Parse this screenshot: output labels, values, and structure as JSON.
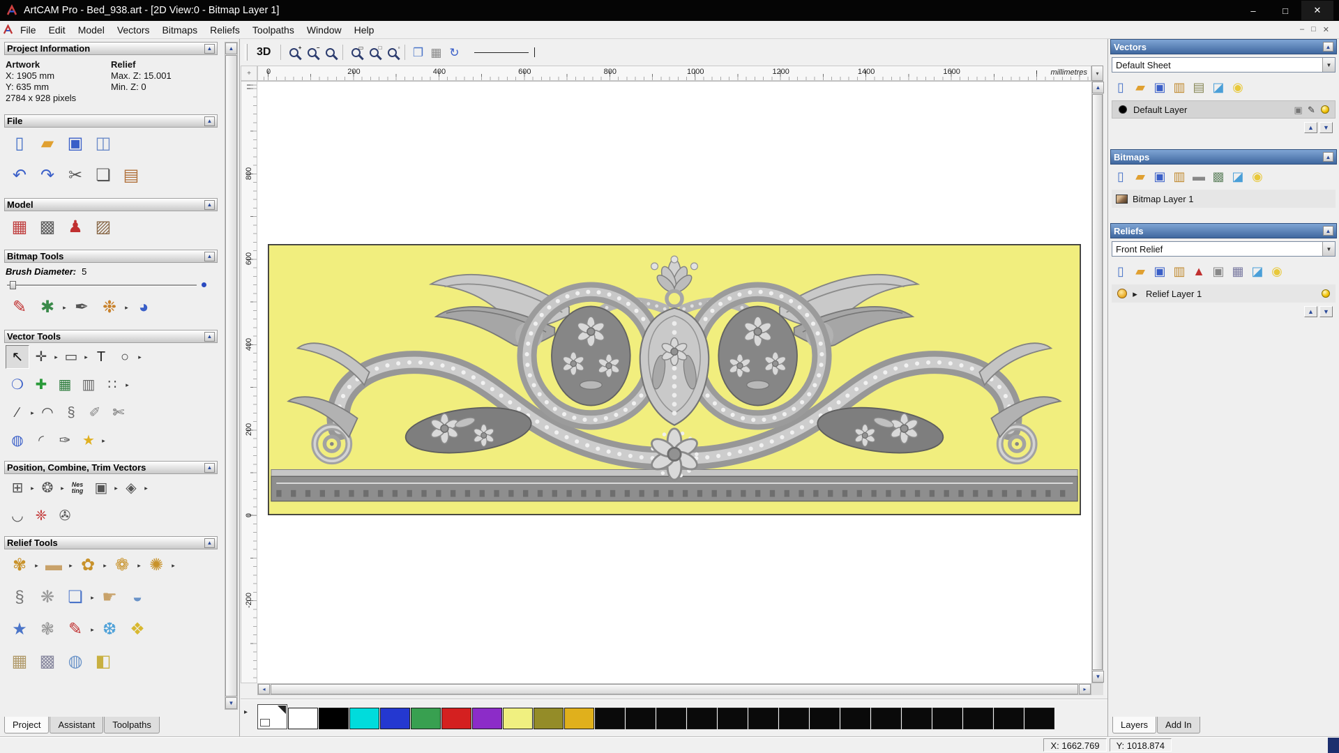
{
  "ui": {
    "collapse_glyph": "▲",
    "dropdown_glyph": "▼",
    "scroll_up": "▲",
    "scroll_down": "▼",
    "scroll_left": "◂",
    "scroll_right": "▸",
    "corner_glyph": "+",
    "ruler_split_glyph": "▾",
    "palette_expand_glyph": "▸"
  },
  "window": {
    "title": "ArtCAM Pro - Bed_938.art - [2D View:0 - Bitmap Layer 1]",
    "controls": {
      "minimize": "–",
      "maximize": "□",
      "close": "✕"
    },
    "mdi_controls": {
      "minimize": "–",
      "restore": "□",
      "close": "✕"
    }
  },
  "menu": {
    "items": [
      "File",
      "Edit",
      "Model",
      "Vectors",
      "Bitmaps",
      "Reliefs",
      "Toolpaths",
      "Window",
      "Help"
    ]
  },
  "left_panel": {
    "project_info": {
      "title": "Project Information",
      "artwork_heading": "Artwork",
      "relief_heading": "Relief",
      "x": "X: 1905 mm",
      "y": "Y: 635 mm",
      "pixels": "2784 x 928 pixels",
      "max_z": "Max. Z: 15.001",
      "min_z": "Min. Z: 0"
    },
    "file_section": {
      "title": "File"
    },
    "file_icons_row1": [
      {
        "name": "new-model-icon",
        "glyph": "▯",
        "color": "#4a74c8"
      },
      {
        "name": "open-model-icon",
        "glyph": "▰",
        "color": "#e0a030"
      },
      {
        "name": "save-model-icon",
        "glyph": "▣",
        "color": "#3a5fc8"
      },
      {
        "name": "export-model-icon",
        "glyph": "◫",
        "color": "#6a8ac8"
      }
    ],
    "file_icons_row2": [
      {
        "name": "undo-icon",
        "glyph": "↶",
        "color": "#3a5fc8"
      },
      {
        "name": "redo-icon",
        "glyph": "↷",
        "color": "#3a5fc8"
      },
      {
        "name": "cut-icon",
        "glyph": "✂",
        "color": "#555555"
      },
      {
        "name": "copy-icon",
        "glyph": "❏",
        "color": "#555555"
      },
      {
        "name": "paste-icon",
        "glyph": "▤",
        "color": "#b0703a"
      }
    ],
    "model_section": {
      "title": "Model"
    },
    "model_icons": [
      {
        "name": "set-model-size-icon",
        "glyph": "▦",
        "color": "#c04040"
      },
      {
        "name": "copy-model-icon",
        "glyph": "▩",
        "color": "#606060"
      },
      {
        "name": "lighting-material-icon",
        "glyph": "♟",
        "color": "#c03030"
      },
      {
        "name": "model-picture-icon",
        "glyph": "▨",
        "color": "#8a6a4a"
      }
    ],
    "bitmap_tools": {
      "title": "Bitmap Tools",
      "brush_diameter_label": "Brush Diameter:",
      "brush_diameter_value": "5"
    },
    "bitmap_icons": [
      {
        "name": "paint-brush-icon",
        "glyph": "✎",
        "color": "#c03030"
      },
      {
        "name": "flood-fill-icon",
        "glyph": "✱",
        "color": "#3a8a4a",
        "arrow": true
      },
      {
        "name": "colour-picker-icon",
        "glyph": "✒",
        "color": "#555555"
      },
      {
        "name": "palette-icon",
        "glyph": "❉",
        "color": "#c8812a",
        "arrow": true
      },
      {
        "name": "paint-bucket-icon",
        "glyph": "◕",
        "color": "#3a5fc8"
      }
    ],
    "vector_tools": {
      "title": "Vector Tools"
    },
    "vector_icons_row1": [
      {
        "name": "select-vectors-icon",
        "glyph": "↖",
        "color": "#111111",
        "pressed": true
      },
      {
        "name": "transform-vectors-icon",
        "glyph": "✛",
        "color": "#444444",
        "arrow": true
      },
      {
        "name": "create-rectangle-icon",
        "glyph": "▭",
        "color": "#444444",
        "arrow": true
      },
      {
        "name": "create-text-icon",
        "glyph": "T",
        "color": "#222222"
      },
      {
        "name": "create-ellipse-icon",
        "glyph": "○",
        "color": "#444444",
        "arrow": true
      }
    ],
    "vector_icons_row2": [
      {
        "name": "offset-vectors-icon",
        "glyph": "❍",
        "color": "#3a5fc8"
      },
      {
        "name": "node-editing-icon",
        "glyph": "✚",
        "color": "#2a9a3a"
      },
      {
        "name": "bitmap-to-vector-icon",
        "glyph": "▦",
        "color": "#2a7a3a"
      },
      {
        "name": "paste-along-curve-icon",
        "glyph": "▥",
        "color": "#666666"
      },
      {
        "name": "block-copy-icon",
        "glyph": "∷",
        "color": "#555555",
        "arrow": true
      }
    ],
    "vector_icons_row3": [
      {
        "name": "create-polyline-icon",
        "glyph": "∕",
        "color": "#444444",
        "arrow": true
      },
      {
        "name": "create-arc-icon",
        "glyph": "◠",
        "color": "#444444"
      },
      {
        "name": "convert-to-curves-icon",
        "glyph": "§",
        "color": "#666666"
      },
      {
        "name": "measure-icon",
        "glyph": "✐",
        "color": "#888888"
      },
      {
        "name": "trim-vectors-icon",
        "glyph": "✄",
        "color": "#555555"
      }
    ],
    "vector_icons_row4": [
      {
        "name": "create-cylinder-icon",
        "glyph": "◍",
        "color": "#3a5fc8"
      },
      {
        "name": "fillet-icon",
        "glyph": "◜",
        "color": "#555555"
      },
      {
        "name": "bezier-pen-icon",
        "glyph": "✑",
        "color": "#555555"
      },
      {
        "name": "create-star-icon",
        "glyph": "★",
        "color": "#e0b020",
        "arrow": true
      }
    ],
    "position_section": {
      "title": "Position, Combine, Trim Vectors"
    },
    "position_icons_row1": [
      {
        "name": "block-array-icon",
        "glyph": "⊞",
        "color": "#555555",
        "arrow": true
      },
      {
        "name": "circular-array-icon",
        "glyph": "❂",
        "color": "#555555",
        "arrow": true
      },
      {
        "name": "nesting-icon",
        "glyph": "Nes\nting",
        "color": "#222222",
        "small": true
      },
      {
        "name": "align-vectors-icon",
        "glyph": "▣",
        "color": "#555555",
        "arrow": true
      },
      {
        "name": "weld-vectors-icon",
        "glyph": "◈",
        "color": "#555555",
        "arrow": true
      }
    ],
    "position_icons_row2": [
      {
        "name": "fillet-weld-icon",
        "glyph": "◡",
        "color": "#555555"
      },
      {
        "name": "vector-texture-icon",
        "glyph": "❈",
        "color": "#c03030"
      },
      {
        "name": "spiral-icon",
        "glyph": "✇",
        "color": "#555555"
      }
    ],
    "relief_tools": {
      "title": "Relief Tools"
    },
    "relief_icons_row1": [
      {
        "name": "relief-wizard-icon",
        "glyph": "✾",
        "color": "#c8922a",
        "arrow": true
      },
      {
        "name": "smooth-relief-icon",
        "glyph": "▬",
        "color": "#c8a26a",
        "arrow": true
      },
      {
        "name": "shape-editor-icon",
        "glyph": "✿",
        "color": "#c8922a",
        "arrow": true
      },
      {
        "name": "two-rail-sweep-icon",
        "glyph": "❁",
        "color": "#c8922a",
        "arrow": true
      },
      {
        "name": "extrude-relief-icon",
        "glyph": "✺",
        "color": "#c8922a",
        "arrow": true
      }
    ],
    "relief_icons_row2": [
      {
        "name": "swept-profile-icon",
        "glyph": "§",
        "color": "#777777"
      },
      {
        "name": "weave-wizard-icon",
        "glyph": "❋",
        "color": "#999999"
      },
      {
        "name": "constant-relief-icon",
        "glyph": "❏",
        "color": "#4a74c8",
        "arrow": true
      },
      {
        "name": "interactive-sculpt-icon",
        "glyph": "☛",
        "color": "#c8a26a"
      },
      {
        "name": "dome-relief-icon",
        "glyph": "◒",
        "color": "#6a93c8"
      }
    ],
    "relief_icons_row3": [
      {
        "name": "star-relief-icon",
        "glyph": "★",
        "color": "#4a74c8"
      },
      {
        "name": "wreath-relief-icon",
        "glyph": "❃",
        "color": "#999999"
      },
      {
        "name": "paint-relief-icon",
        "glyph": "✎",
        "color": "#c03030",
        "arrow": true
      },
      {
        "name": "texture-relief-icon",
        "glyph": "❆",
        "color": "#4a9fd8"
      },
      {
        "name": "offset-relief-icon",
        "glyph": "❖",
        "color": "#d8b830"
      }
    ],
    "relief_icons_row4": [
      {
        "name": "pattern-relief-icon",
        "glyph": "▦",
        "color": "#b09a6a"
      },
      {
        "name": "mesh-relief-icon",
        "glyph": "▩",
        "color": "#8a8aa0"
      },
      {
        "name": "clay-relief-icon",
        "glyph": "◍",
        "color": "#6a93c8"
      },
      {
        "name": "layer-relief-icon",
        "glyph": "◧",
        "color": "#c8b040"
      }
    ],
    "tabs": [
      {
        "label": "Project",
        "active": true
      },
      {
        "label": "Assistant",
        "active": false
      },
      {
        "label": "Toolpaths",
        "active": false
      }
    ]
  },
  "canvas": {
    "toolbar": {
      "view_3d": "3D",
      "icons": [
        {
          "name": "separator-1",
          "type": "sep"
        },
        {
          "name": "zoom-in-icon",
          "type": "mag",
          "sub": "+"
        },
        {
          "name": "zoom-out-icon",
          "type": "mag",
          "sub": "−"
        },
        {
          "name": "zoom-previous-icon",
          "type": "mag"
        },
        {
          "name": "separator-2",
          "type": "sep"
        },
        {
          "name": "zoom-window-icon",
          "type": "mag",
          "sub": "▭"
        },
        {
          "name": "zoom-objects-icon",
          "type": "mag",
          "sub": "□"
        },
        {
          "name": "zoom-page-icon",
          "type": "mag",
          "sub": "▫"
        },
        {
          "name": "separator-3",
          "type": "sep"
        },
        {
          "name": "preview-pages-icon",
          "glyph": "❐",
          "color": "#4a74c8"
        },
        {
          "name": "snap-grid-icon",
          "glyph": "▦",
          "color": "#888888"
        },
        {
          "name": "redraw-view-icon",
          "glyph": "↻",
          "color": "#3a5fc8"
        }
      ]
    },
    "ruler": {
      "h_ticks": [
        "0",
        "200",
        "400",
        "600",
        "800",
        "1000",
        "1200",
        "1400",
        "1600"
      ],
      "v_ticks": [
        "800",
        "600",
        "400",
        "200",
        "0",
        "-200"
      ],
      "units": "millimetres"
    }
  },
  "palette": {
    "colors": [
      {
        "name": "current-colour-indicator",
        "color": "#ffffff",
        "special": true
      },
      {
        "name": "colour-white",
        "color": "#ffffff"
      },
      {
        "name": "colour-black",
        "color": "#000000"
      },
      {
        "name": "colour-cyan",
        "color": "#00dcdc"
      },
      {
        "name": "colour-blue",
        "color": "#2438d0"
      },
      {
        "name": "colour-green",
        "color": "#38a050"
      },
      {
        "name": "colour-red",
        "color": "#d42020"
      },
      {
        "name": "colour-magenta",
        "color": "#8c2cc8"
      },
      {
        "name": "colour-light-yellow",
        "color": "#f0f080"
      },
      {
        "name": "colour-olive",
        "color": "#948c28"
      },
      {
        "name": "colour-gold",
        "color": "#e0b01c"
      },
      {
        "name": "colour-black-2",
        "color": "#0a0a0a"
      },
      {
        "name": "colour-black-3",
        "color": "#0a0a0a"
      },
      {
        "name": "colour-black-4",
        "color": "#0a0a0a"
      },
      {
        "name": "colour-black-5",
        "color": "#0a0a0a"
      },
      {
        "name": "colour-black-6",
        "color": "#0a0a0a"
      },
      {
        "name": "colour-black-7",
        "color": "#0a0a0a"
      },
      {
        "name": "colour-black-8",
        "color": "#0a0a0a"
      },
      {
        "name": "colour-black-9",
        "color": "#0a0a0a"
      },
      {
        "name": "colour-black-10",
        "color": "#0a0a0a"
      },
      {
        "name": "colour-black-11",
        "color": "#0a0a0a"
      },
      {
        "name": "colour-black-12",
        "color": "#0a0a0a"
      },
      {
        "name": "colour-black-13",
        "color": "#0a0a0a"
      },
      {
        "name": "colour-black-14",
        "color": "#0a0a0a"
      },
      {
        "name": "colour-black-15",
        "color": "#0a0a0a"
      },
      {
        "name": "colour-black-16",
        "color": "#0a0a0a"
      }
    ]
  },
  "right_panel": {
    "vectors": {
      "title": "Vectors",
      "sheet_selector": "Default Sheet",
      "toolbar": [
        {
          "name": "new-vector-sheet-icon",
          "glyph": "▯",
          "color": "#4a74c8"
        },
        {
          "name": "open-vector-file-icon",
          "glyph": "▰",
          "color": "#e0a030"
        },
        {
          "name": "save-vectors-icon",
          "glyph": "▣",
          "color": "#3a5fc8"
        },
        {
          "name": "import-vectors-icon",
          "glyph": "▥",
          "color": "#c08a30"
        },
        {
          "name": "export-vectors-icon",
          "glyph": "▤",
          "color": "#8a8a5a"
        },
        {
          "name": "delete-vectors-icon",
          "glyph": "◪",
          "color": "#4a9fd8"
        },
        {
          "name": "show-all-vectors-icon",
          "glyph": "◉",
          "color": "#e8c83a"
        }
      ],
      "layer_label": "Default Layer",
      "layer_left_icons": [
        {
          "name": "layer-colour-swatch",
          "type": "dot"
        }
      ],
      "layer_right_icons": [
        {
          "name": "merge-layer-icon",
          "glyph": "▣",
          "color": "#777777"
        },
        {
          "name": "edit-layer-icon",
          "glyph": "✎",
          "color": "#333333"
        },
        {
          "name": "layer-visibility-bulb",
          "type": "bulb"
        }
      ],
      "updown": [
        {
          "name": "move-vector-layer-up-button",
          "glyph": "▲",
          "color": "#2a4a9a"
        },
        {
          "name": "move-vector-layer-down-button",
          "glyph": "▼",
          "color": "#2a4a9a"
        }
      ]
    },
    "bitmaps": {
      "title": "Bitmaps",
      "toolbar": [
        {
          "name": "new-bitmap-layer-icon",
          "glyph": "▯",
          "color": "#4a74c8"
        },
        {
          "name": "open-bitmap-file-icon",
          "glyph": "▰",
          "color": "#e0a030"
        },
        {
          "name": "save-bitmap-icon",
          "glyph": "▣",
          "color": "#3a5fc8"
        },
        {
          "name": "import-bitmap-icon",
          "glyph": "▥",
          "color": "#c08a30"
        },
        {
          "name": "merge-bitmap-layers-icon",
          "glyph": "▬",
          "color": "#888888"
        },
        {
          "name": "greyscale-bitmap-icon",
          "glyph": "▩",
          "color": "#6a8a6a"
        },
        {
          "name": "delete-bitmap-icon",
          "glyph": "◪",
          "color": "#4a9fd8"
        },
        {
          "name": "show-all-bitmaps-icon",
          "glyph": "◉",
          "color": "#e8c83a"
        }
      ],
      "layer_label": "Bitmap Layer 1",
      "layer_left_icons": [
        {
          "name": "bitmap-thumbnail-icon",
          "type": "pic"
        }
      ],
      "layer_right_icons": []
    },
    "reliefs": {
      "title": "Reliefs",
      "relief_selector": "Front Relief",
      "toolbar": [
        {
          "name": "new-relief-layer-icon",
          "glyph": "▯",
          "color": "#4a74c8"
        },
        {
          "name": "open-relief-file-icon",
          "glyph": "▰",
          "color": "#e0a030"
        },
        {
          "name": "save-relief-icon",
          "glyph": "▣",
          "color": "#3a5fc8"
        },
        {
          "name": "import-relief-icon",
          "glyph": "▥",
          "color": "#c08a30"
        },
        {
          "name": "calculate-relief-icon",
          "glyph": "▲",
          "color": "#c03030"
        },
        {
          "name": "smooth-relief-layer-icon",
          "glyph": "▣",
          "color": "#888888"
        },
        {
          "name": "scale-relief-icon",
          "glyph": "▦",
          "color": "#7a7aa0"
        },
        {
          "name": "delete-relief-icon",
          "glyph": "◪",
          "color": "#4a9fd8"
        },
        {
          "name": "show-all-reliefs-icon",
          "glyph": "◉",
          "color": "#e8c83a"
        }
      ],
      "layer_label": "Relief Layer 1",
      "layer_left_icons": [
        {
          "name": "relief-thumbnail-icon",
          "type": "sun"
        },
        {
          "name": "relief-layer-expander",
          "glyph": "▸",
          "color": "#222222"
        }
      ],
      "layer_right_icons": [
        {
          "name": "relief-visibility-bulb",
          "type": "bulb"
        }
      ],
      "updown": [
        {
          "name": "move-relief-layer-up-button",
          "glyph": "▲",
          "color": "#2a4a9a"
        },
        {
          "name": "move-relief-layer-down-button",
          "glyph": "▼",
          "color": "#2a4a9a"
        }
      ]
    },
    "tabs": [
      {
        "label": "Layers",
        "active": true
      },
      {
        "label": "Add In",
        "active": false
      }
    ]
  },
  "status_bar": {
    "x": "X: 1662.769",
    "y": "Y: 1018.874"
  },
  "colors": {
    "canvas_yellow": "#f1ee7e",
    "header_blue": "#3f679f",
    "relief_grey": "#9a9a9a"
  }
}
